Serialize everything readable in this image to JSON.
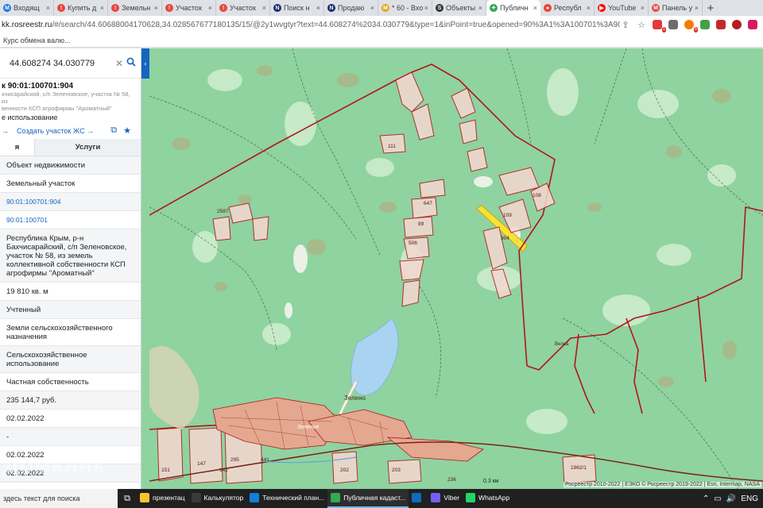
{
  "browser": {
    "tabs": [
      {
        "label": "Входящ",
        "color": "#1a73e8",
        "glyph": "M"
      },
      {
        "label": "Купить д",
        "color": "#e8453c",
        "glyph": "!"
      },
      {
        "label": "Земельн",
        "color": "#e8453c",
        "glyph": "!"
      },
      {
        "label": "Участок",
        "color": "#e8453c",
        "glyph": "!"
      },
      {
        "label": "Участок",
        "color": "#e8453c",
        "glyph": "!"
      },
      {
        "label": "Поиск н",
        "color": "#1a2b6b",
        "glyph": "N"
      },
      {
        "label": "Продаю",
        "color": "#1a2b6b",
        "glyph": "N"
      },
      {
        "label": "* 60 - Вхо",
        "color": "#e8a317",
        "glyph": "M"
      },
      {
        "label": "Объекты",
        "color": "#333333",
        "glyph": "S"
      },
      {
        "label": "Публичн",
        "color": "#34a853",
        "glyph": "✦",
        "active": true
      },
      {
        "label": "Республ",
        "color": "#ea4335",
        "glyph": "●"
      },
      {
        "label": "YouTube",
        "color": "#ff0000",
        "glyph": "▶"
      },
      {
        "label": "Панель у",
        "color": "#e8453c",
        "glyph": "M"
      }
    ],
    "new_tab": "+",
    "url_host": "kk.rosreestr.ru",
    "url_rest": "/#/search/44.60688004170628,34.028567677180135/15/@2y1wvgtyr?text=44.608274%2034.030779&type=1&inPoint=true&opened=90%3A1%3A100701%3A904",
    "bookmark": "Курс обмена валю..."
  },
  "panel": {
    "search_value": "44.608274 34.030779",
    "collapse_glyph": "‹",
    "object_title": "к 90:01:100701:904",
    "object_address_1": "хчисарайский, с/п Зеленовское, участок № 58, из",
    "object_address_2": "венности КСП агрофирмы \"Ароматный\"",
    "object_use": "е использование",
    "action_arrow": "→",
    "action_create": "Создать участок ЖС →",
    "tabs": [
      "я",
      "Услуги"
    ],
    "rows": [
      {
        "text": "Объект недвижимости",
        "style": "alt"
      },
      {
        "text": "Земельный участок",
        "style": ""
      },
      {
        "text": "90:01:100701:904",
        "style": "link alt"
      },
      {
        "text": "90:01:100701",
        "style": "link"
      },
      {
        "text": "Республика Крым, р-н Бахчисарайский, с/п Зеленовское, участок № 58, из земель коллективной собственности КСП агрофирмы \"Ароматный\"",
        "style": "alt"
      },
      {
        "text": "19 810 кв. м",
        "style": ""
      },
      {
        "text": "Учтенный",
        "style": "alt"
      },
      {
        "text": "Земли сельскохозяйственного назначения",
        "style": ""
      },
      {
        "text": "Сельскохозяйственное использование",
        "style": "alt"
      },
      {
        "text": "Частная собственность",
        "style": ""
      },
      {
        "text": "235 144,7 руб.",
        "style": "alt"
      },
      {
        "text": "02.02.2022",
        "style": ""
      },
      {
        "text": "-",
        "style": "alt"
      },
      {
        "text": "02.02.2022",
        "style": ""
      },
      {
        "text": "02.02.2022",
        "style": "alt"
      }
    ]
  },
  "map": {
    "attribution": "Росреестр 2010-2022 | ЕЭКО © Росреестр 2019-2022 | Esri, Intermap, NASA",
    "scale": "0.3 км",
    "places": [
      {
        "text": "Зелено"
      },
      {
        "text": "Зеленое"
      },
      {
        "text": "Вилна"
      }
    ],
    "parcel_labels": [
      "111",
      "647",
      "89",
      "506",
      "109",
      "904",
      "108",
      "2587",
      "295",
      "441",
      "203",
      "151",
      "1962/1",
      "236",
      "147",
      "142",
      "202"
    ]
  },
  "watermark": "Домклик",
  "taskbar": {
    "search": "здесь текст для поиска",
    "items": [
      {
        "label": "презентац",
        "color": "#f4c430"
      },
      {
        "label": "Калькулятор",
        "color": "#3a3a3a"
      },
      {
        "label": "Технический план...",
        "color": "#0f7fd9"
      },
      {
        "label": "Публичная кадаст...",
        "color": "#34a853",
        "open": true
      },
      {
        "label": "",
        "color": "#0f6cbd"
      },
      {
        "label": "Viber",
        "color": "#7360f2"
      },
      {
        "label": "WhatsApp",
        "color": "#25d366"
      }
    ],
    "tray": [
      "⌃",
      "▭",
      "🔊",
      "ENG"
    ]
  }
}
